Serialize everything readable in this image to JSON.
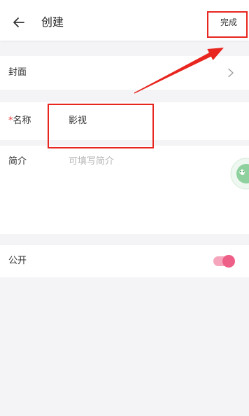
{
  "header": {
    "back_icon": "arrow-left-icon",
    "title": "创建",
    "done_label": "完成"
  },
  "form": {
    "cover": {
      "label": "封面",
      "icon": "chevron-right-icon"
    },
    "name": {
      "required_mark": "*",
      "label": "名称",
      "value": "影视"
    },
    "intro": {
      "label": "简介",
      "placeholder": "可填写简介"
    },
    "public": {
      "label": "公开",
      "enabled": true
    }
  },
  "floating_button": {
    "icon": "assistant-icon"
  },
  "colors": {
    "background": "#f4f4f6",
    "accent": "#ee5f87",
    "required": "#e53935",
    "annotation": "#e8261f",
    "assistant": "#8fd19e"
  }
}
